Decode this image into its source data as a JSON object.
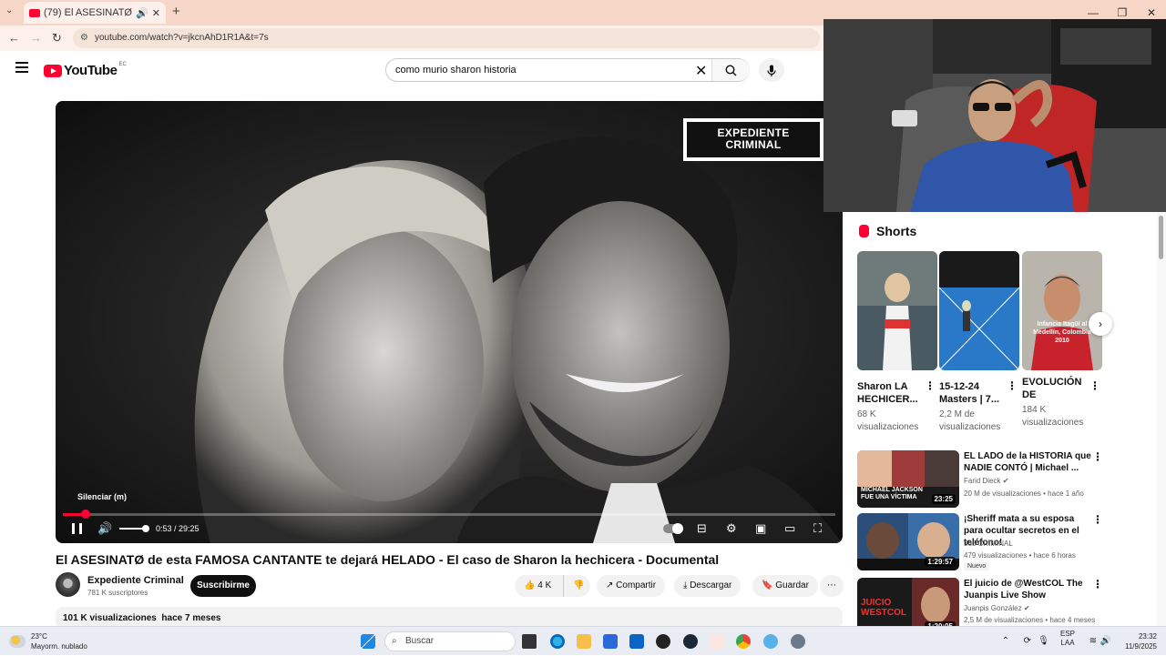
{
  "browser": {
    "tab_title": "(79) El ASESINATØ de esta F",
    "url": "youtube.com/watch?v=jkcnAhD1R1A&t=7s"
  },
  "youtube": {
    "logo_text": "YouTube",
    "country_code": "EC",
    "search_query": "como murio sharon historia"
  },
  "player": {
    "channel_badge_line1": "EXPEDIENTE",
    "channel_badge_line2": "CRIMINAL",
    "tooltip": "Silenciar (m)",
    "current_time": "0:53",
    "duration": "29:25",
    "time_display": "0:53 / 29:25",
    "progress_fraction": 0.03,
    "volume_fraction": 1.0
  },
  "video": {
    "title": "El ASESINATØ de esta FAMOSA CANTANTE te dejará HELADO - El caso de Sharon la hechicera - Documental",
    "channel_name": "Expediente Criminal",
    "subscribers": "781 K suscriptores",
    "subscribe_label": "Suscribirme",
    "likes": "4 K",
    "share_label": "Compartir",
    "download_label": "Descargar",
    "save_label": "Guardar",
    "views": "101 K visualizaciones",
    "age": "hace 7 meses"
  },
  "shorts": {
    "heading": "Shorts",
    "items": [
      {
        "title": "Sharon LA HECHICER...",
        "views": "68 K visualizaciones"
      },
      {
        "title": "15-12-24 Masters | 7...",
        "views": "2,2 M de visualizaciones"
      },
      {
        "title": "EVOLUCIÓN DE BLESSD...",
        "views": "184 K visualizaciones",
        "thumb_text": "Infancia Itagüí al Medellín, Colombia 2010"
      }
    ]
  },
  "recommendations": [
    {
      "title": "EL LADO de la HISTORIA que NADIE CONTÓ | Michael ...",
      "channel": "Farid Dieck",
      "verified": true,
      "meta": "20 M de visualizaciones • hace 1 año",
      "duration": "23:25",
      "thumb_text": "MICHAEL JACKSON FUE UNA VÍCTIMA"
    },
    {
      "title": "¡Sheriff mata a su esposa para ocultar secretos en el teléfono!",
      "channel": "365 CRIMINAL",
      "verified": false,
      "meta": "479 visualizaciones • hace 6 horas",
      "duration": "1:29:57",
      "badge": "Nuevo"
    },
    {
      "title": "El juicio de @WestCOL The Juanpis Live Show",
      "channel": "Juanpis González",
      "verified": true,
      "meta": "2,5 M de visualizaciones • hace 4 meses",
      "duration": "1:20:05",
      "thumb_text": "JUICIO WESTCOL"
    }
  ],
  "taskbar": {
    "temperature": "23°C",
    "weather": "Mayorm. nublado",
    "search_placeholder": "Buscar",
    "lang1": "ESP",
    "lang2": "LAA",
    "time": "23:32",
    "date": "11/9/2025"
  }
}
